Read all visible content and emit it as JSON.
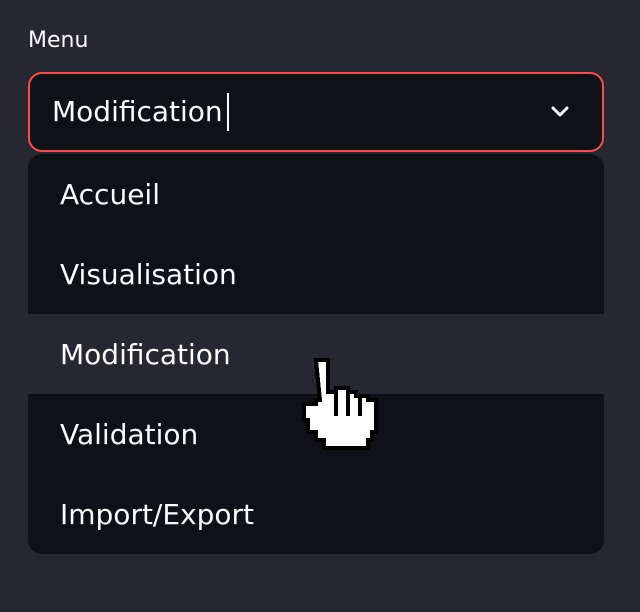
{
  "menu": {
    "label": "Menu",
    "selected_value": "Modification",
    "chevron_icon": "chevron-down-icon",
    "accent_color": "#ff4b4b",
    "options": [
      {
        "label": "Accueil"
      },
      {
        "label": "Visualisation"
      },
      {
        "label": "Modification"
      },
      {
        "label": "Validation"
      },
      {
        "label": "Import/Export"
      }
    ],
    "highlighted_option": "Modification"
  },
  "cursor": {
    "icon": "hand-pointer-icon"
  }
}
